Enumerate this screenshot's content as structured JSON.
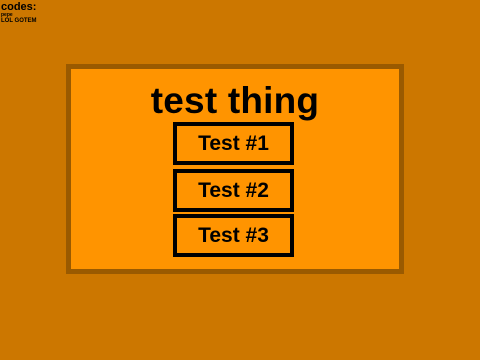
{
  "codes": {
    "title": "codes:",
    "items": [
      "pepe",
      "LOL GOTEM"
    ]
  },
  "panel": {
    "title": "test thing",
    "buttons": [
      {
        "label": "Test #1"
      },
      {
        "label": "Test #2"
      },
      {
        "label": "Test #3"
      }
    ]
  },
  "colors": {
    "background": "#CC7700",
    "panel_fill": "#FF9400",
    "panel_border": "#9A5A00",
    "button_border": "#000000",
    "text": "#000000"
  }
}
